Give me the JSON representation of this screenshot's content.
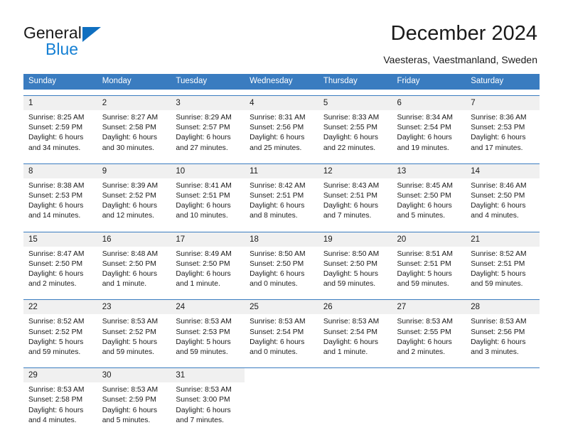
{
  "brand": {
    "name_part1": "General",
    "name_part2": "Blue",
    "triangle_color": "#0f6fc0",
    "blue_color": "#1580d4"
  },
  "header": {
    "title": "December 2024",
    "subtitle": "Vaesteras, Vaestmanland, Sweden"
  },
  "theme": {
    "header_blue": "#3a7cc0",
    "daynum_band": "#f0f0f0"
  },
  "weekdays": [
    "Sunday",
    "Monday",
    "Tuesday",
    "Wednesday",
    "Thursday",
    "Friday",
    "Saturday"
  ],
  "labels": {
    "sunrise_prefix": "Sunrise:",
    "sunset_prefix": "Sunset:",
    "daylight_prefix": "Daylight:"
  },
  "weeks": [
    [
      {
        "day": "1",
        "sunrise": "Sunrise: 8:25 AM",
        "sunset": "Sunset: 2:59 PM",
        "daylight_line1": "Daylight: 6 hours",
        "daylight_line2": "and 34 minutes."
      },
      {
        "day": "2",
        "sunrise": "Sunrise: 8:27 AM",
        "sunset": "Sunset: 2:58 PM",
        "daylight_line1": "Daylight: 6 hours",
        "daylight_line2": "and 30 minutes."
      },
      {
        "day": "3",
        "sunrise": "Sunrise: 8:29 AM",
        "sunset": "Sunset: 2:57 PM",
        "daylight_line1": "Daylight: 6 hours",
        "daylight_line2": "and 27 minutes."
      },
      {
        "day": "4",
        "sunrise": "Sunrise: 8:31 AM",
        "sunset": "Sunset: 2:56 PM",
        "daylight_line1": "Daylight: 6 hours",
        "daylight_line2": "and 25 minutes."
      },
      {
        "day": "5",
        "sunrise": "Sunrise: 8:33 AM",
        "sunset": "Sunset: 2:55 PM",
        "daylight_line1": "Daylight: 6 hours",
        "daylight_line2": "and 22 minutes."
      },
      {
        "day": "6",
        "sunrise": "Sunrise: 8:34 AM",
        "sunset": "Sunset: 2:54 PM",
        "daylight_line1": "Daylight: 6 hours",
        "daylight_line2": "and 19 minutes."
      },
      {
        "day": "7",
        "sunrise": "Sunrise: 8:36 AM",
        "sunset": "Sunset: 2:53 PM",
        "daylight_line1": "Daylight: 6 hours",
        "daylight_line2": "and 17 minutes."
      }
    ],
    [
      {
        "day": "8",
        "sunrise": "Sunrise: 8:38 AM",
        "sunset": "Sunset: 2:53 PM",
        "daylight_line1": "Daylight: 6 hours",
        "daylight_line2": "and 14 minutes."
      },
      {
        "day": "9",
        "sunrise": "Sunrise: 8:39 AM",
        "sunset": "Sunset: 2:52 PM",
        "daylight_line1": "Daylight: 6 hours",
        "daylight_line2": "and 12 minutes."
      },
      {
        "day": "10",
        "sunrise": "Sunrise: 8:41 AM",
        "sunset": "Sunset: 2:51 PM",
        "daylight_line1": "Daylight: 6 hours",
        "daylight_line2": "and 10 minutes."
      },
      {
        "day": "11",
        "sunrise": "Sunrise: 8:42 AM",
        "sunset": "Sunset: 2:51 PM",
        "daylight_line1": "Daylight: 6 hours",
        "daylight_line2": "and 8 minutes."
      },
      {
        "day": "12",
        "sunrise": "Sunrise: 8:43 AM",
        "sunset": "Sunset: 2:51 PM",
        "daylight_line1": "Daylight: 6 hours",
        "daylight_line2": "and 7 minutes."
      },
      {
        "day": "13",
        "sunrise": "Sunrise: 8:45 AM",
        "sunset": "Sunset: 2:50 PM",
        "daylight_line1": "Daylight: 6 hours",
        "daylight_line2": "and 5 minutes."
      },
      {
        "day": "14",
        "sunrise": "Sunrise: 8:46 AM",
        "sunset": "Sunset: 2:50 PM",
        "daylight_line1": "Daylight: 6 hours",
        "daylight_line2": "and 4 minutes."
      }
    ],
    [
      {
        "day": "15",
        "sunrise": "Sunrise: 8:47 AM",
        "sunset": "Sunset: 2:50 PM",
        "daylight_line1": "Daylight: 6 hours",
        "daylight_line2": "and 2 minutes."
      },
      {
        "day": "16",
        "sunrise": "Sunrise: 8:48 AM",
        "sunset": "Sunset: 2:50 PM",
        "daylight_line1": "Daylight: 6 hours",
        "daylight_line2": "and 1 minute."
      },
      {
        "day": "17",
        "sunrise": "Sunrise: 8:49 AM",
        "sunset": "Sunset: 2:50 PM",
        "daylight_line1": "Daylight: 6 hours",
        "daylight_line2": "and 1 minute."
      },
      {
        "day": "18",
        "sunrise": "Sunrise: 8:50 AM",
        "sunset": "Sunset: 2:50 PM",
        "daylight_line1": "Daylight: 6 hours",
        "daylight_line2": "and 0 minutes."
      },
      {
        "day": "19",
        "sunrise": "Sunrise: 8:50 AM",
        "sunset": "Sunset: 2:50 PM",
        "daylight_line1": "Daylight: 5 hours",
        "daylight_line2": "and 59 minutes."
      },
      {
        "day": "20",
        "sunrise": "Sunrise: 8:51 AM",
        "sunset": "Sunset: 2:51 PM",
        "daylight_line1": "Daylight: 5 hours",
        "daylight_line2": "and 59 minutes."
      },
      {
        "day": "21",
        "sunrise": "Sunrise: 8:52 AM",
        "sunset": "Sunset: 2:51 PM",
        "daylight_line1": "Daylight: 5 hours",
        "daylight_line2": "and 59 minutes."
      }
    ],
    [
      {
        "day": "22",
        "sunrise": "Sunrise: 8:52 AM",
        "sunset": "Sunset: 2:52 PM",
        "daylight_line1": "Daylight: 5 hours",
        "daylight_line2": "and 59 minutes."
      },
      {
        "day": "23",
        "sunrise": "Sunrise: 8:53 AM",
        "sunset": "Sunset: 2:52 PM",
        "daylight_line1": "Daylight: 5 hours",
        "daylight_line2": "and 59 minutes."
      },
      {
        "day": "24",
        "sunrise": "Sunrise: 8:53 AM",
        "sunset": "Sunset: 2:53 PM",
        "daylight_line1": "Daylight: 5 hours",
        "daylight_line2": "and 59 minutes."
      },
      {
        "day": "25",
        "sunrise": "Sunrise: 8:53 AM",
        "sunset": "Sunset: 2:54 PM",
        "daylight_line1": "Daylight: 6 hours",
        "daylight_line2": "and 0 minutes."
      },
      {
        "day": "26",
        "sunrise": "Sunrise: 8:53 AM",
        "sunset": "Sunset: 2:54 PM",
        "daylight_line1": "Daylight: 6 hours",
        "daylight_line2": "and 1 minute."
      },
      {
        "day": "27",
        "sunrise": "Sunrise: 8:53 AM",
        "sunset": "Sunset: 2:55 PM",
        "daylight_line1": "Daylight: 6 hours",
        "daylight_line2": "and 2 minutes."
      },
      {
        "day": "28",
        "sunrise": "Sunrise: 8:53 AM",
        "sunset": "Sunset: 2:56 PM",
        "daylight_line1": "Daylight: 6 hours",
        "daylight_line2": "and 3 minutes."
      }
    ],
    [
      {
        "day": "29",
        "sunrise": "Sunrise: 8:53 AM",
        "sunset": "Sunset: 2:58 PM",
        "daylight_line1": "Daylight: 6 hours",
        "daylight_line2": "and 4 minutes."
      },
      {
        "day": "30",
        "sunrise": "Sunrise: 8:53 AM",
        "sunset": "Sunset: 2:59 PM",
        "daylight_line1": "Daylight: 6 hours",
        "daylight_line2": "and 5 minutes."
      },
      {
        "day": "31",
        "sunrise": "Sunrise: 8:53 AM",
        "sunset": "Sunset: 3:00 PM",
        "daylight_line1": "Daylight: 6 hours",
        "daylight_line2": "and 7 minutes."
      },
      {
        "day": "",
        "sunrise": "",
        "sunset": "",
        "daylight_line1": "",
        "daylight_line2": ""
      },
      {
        "day": "",
        "sunrise": "",
        "sunset": "",
        "daylight_line1": "",
        "daylight_line2": ""
      },
      {
        "day": "",
        "sunrise": "",
        "sunset": "",
        "daylight_line1": "",
        "daylight_line2": ""
      },
      {
        "day": "",
        "sunrise": "",
        "sunset": "",
        "daylight_line1": "",
        "daylight_line2": ""
      }
    ]
  ]
}
